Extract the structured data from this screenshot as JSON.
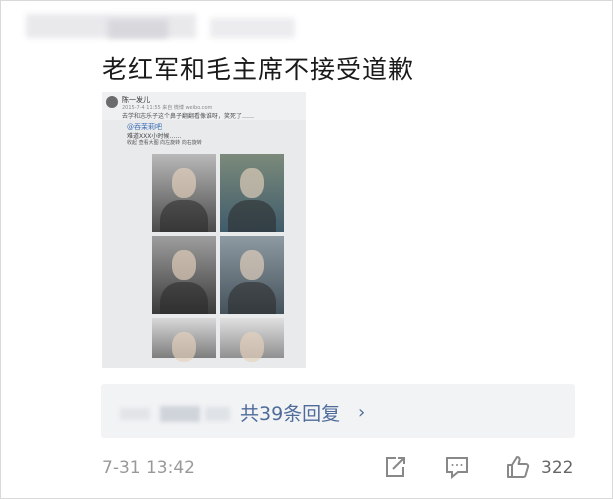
{
  "post": {
    "title": "老红军和毛主席不接受道歉",
    "embedded_screenshot": {
      "username": "陈一发儿",
      "meta": "2015-7-4 11:55 来自 微博 weibo.com",
      "text": "去学和志乐子这个鼻子翻翻看像谁呀，笑死了……",
      "repost_name": "@吞茉莉吧",
      "repost_text": "难道XXX小时候……",
      "actions": "收起  查看大图  向左旋转  向右旋转"
    }
  },
  "replies": {
    "label": "共39条回复",
    "chevron": "›"
  },
  "footer": {
    "timestamp": "7-31 13:42",
    "like_count": "322"
  },
  "icons": {
    "repost": "repost-icon",
    "comment": "comment-icon",
    "like": "thumbs-up-icon"
  },
  "colors": {
    "link": "#4e6b99",
    "muted": "#999999",
    "reply_bg": "#f2f3f5"
  }
}
